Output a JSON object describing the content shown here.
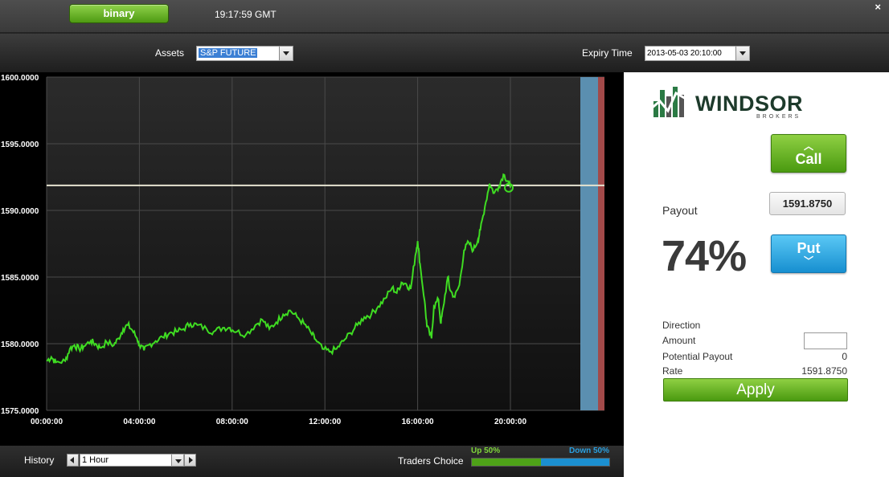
{
  "topbar": {
    "mode_button": "binary",
    "clock": "19:17:59 GMT",
    "close": "×"
  },
  "assetbar": {
    "assets_label": "Assets",
    "asset_value": "S&P FUTURE",
    "expiry_label": "Expiry Time",
    "expiry_value": "2013-05-03 20:10:00"
  },
  "chart_data": {
    "type": "line",
    "ylim": [
      1575,
      1600
    ],
    "yticks": [
      "1600.0000",
      "1595.0000",
      "1590.0000",
      "1585.0000",
      "1580.0000",
      "1575.0000"
    ],
    "xticks": [
      "00:00:00",
      "04:00:00",
      "08:00:00",
      "12:00:00",
      "16:00:00",
      "20:00:00"
    ],
    "strike_level": 1591.875,
    "series": [
      {
        "points": [
          [
            0.0,
            1578.7
          ],
          [
            0.2,
            1579.0
          ],
          [
            0.4,
            1578.6
          ],
          [
            0.8,
            1578.7
          ],
          [
            1.0,
            1579.6
          ],
          [
            1.2,
            1579.9
          ],
          [
            1.4,
            1579.6
          ],
          [
            1.6,
            1579.8
          ],
          [
            1.9,
            1580.2
          ],
          [
            2.1,
            1580.0
          ],
          [
            2.3,
            1579.7
          ],
          [
            2.6,
            1580.1
          ],
          [
            2.9,
            1579.9
          ],
          [
            3.1,
            1580.4
          ],
          [
            3.3,
            1581.1
          ],
          [
            3.5,
            1581.4
          ],
          [
            3.7,
            1581.0
          ],
          [
            3.9,
            1580.4
          ],
          [
            4.0,
            1579.9
          ],
          [
            4.2,
            1579.5
          ],
          [
            4.4,
            1579.9
          ],
          [
            4.7,
            1580.2
          ],
          [
            5.0,
            1580.5
          ],
          [
            5.3,
            1580.8
          ],
          [
            5.6,
            1580.9
          ],
          [
            5.9,
            1581.1
          ],
          [
            6.2,
            1581.5
          ],
          [
            6.5,
            1581.4
          ],
          [
            6.9,
            1581.1
          ],
          [
            7.2,
            1580.9
          ],
          [
            7.6,
            1581.2
          ],
          [
            7.9,
            1581.2
          ],
          [
            8.2,
            1580.9
          ],
          [
            8.6,
            1580.7
          ],
          [
            9.0,
            1581.4
          ],
          [
            9.3,
            1581.8
          ],
          [
            9.6,
            1581.1
          ],
          [
            9.9,
            1581.6
          ],
          [
            10.2,
            1582.2
          ],
          [
            10.5,
            1582.5
          ],
          [
            10.8,
            1582.0
          ],
          [
            11.1,
            1581.5
          ],
          [
            11.4,
            1580.8
          ],
          [
            11.6,
            1580.3
          ],
          [
            11.9,
            1579.6
          ],
          [
            12.2,
            1579.4
          ],
          [
            12.5,
            1579.6
          ],
          [
            12.8,
            1580.2
          ],
          [
            13.1,
            1580.8
          ],
          [
            13.4,
            1581.4
          ],
          [
            13.7,
            1582.0
          ],
          [
            14.0,
            1582.2
          ],
          [
            14.3,
            1582.8
          ],
          [
            14.6,
            1583.4
          ],
          [
            14.9,
            1584.2
          ],
          [
            15.1,
            1583.8
          ],
          [
            15.3,
            1584.6
          ],
          [
            15.5,
            1584.5
          ],
          [
            15.7,
            1584.1
          ],
          [
            15.9,
            1586.6
          ],
          [
            16.0,
            1587.7
          ],
          [
            16.1,
            1586.0
          ],
          [
            16.3,
            1583.2
          ],
          [
            16.4,
            1581.3
          ],
          [
            16.6,
            1580.4
          ],
          [
            16.7,
            1582.8
          ],
          [
            16.9,
            1583.3
          ],
          [
            17.0,
            1581.5
          ],
          [
            17.1,
            1582.7
          ],
          [
            17.3,
            1585.0
          ],
          [
            17.4,
            1584.0
          ],
          [
            17.6,
            1583.5
          ],
          [
            17.8,
            1584.4
          ],
          [
            18.0,
            1587.0
          ],
          [
            18.2,
            1587.6
          ],
          [
            18.4,
            1587.0
          ],
          [
            18.6,
            1587.8
          ],
          [
            18.7,
            1588.5
          ],
          [
            18.9,
            1590.3
          ],
          [
            19.1,
            1592.0
          ],
          [
            19.3,
            1591.3
          ],
          [
            19.5,
            1591.8
          ],
          [
            19.7,
            1592.7
          ],
          [
            19.9,
            1592.2
          ],
          [
            20.0,
            1591.7
          ]
        ]
      }
    ]
  },
  "bottombar": {
    "history_label": "History",
    "history_value": "1 Hour",
    "traders_label": "Traders Choice",
    "up_label": "Up 50%",
    "down_label": "Down 50%",
    "up_pct": 50
  },
  "panel": {
    "logo_text": "WINDSOR",
    "logo_sub": "BROKERS",
    "call_label": "Call",
    "put_label": "Put",
    "payout_label": "Payout",
    "rate_display": "1591.8750",
    "payout_pct": "74%",
    "direction_label": "Direction",
    "amount_label": "Amount",
    "potential_label": "Potential Payout",
    "potential_value": "0",
    "rate_label": "Rate",
    "rate_value": "1591.8750",
    "apply_label": "Apply"
  },
  "colors": {
    "line": "#3fdc22",
    "strike": "#e6e3d0",
    "expiry_band": "#5b8fb0",
    "expiry_line": "#a24a4a"
  }
}
